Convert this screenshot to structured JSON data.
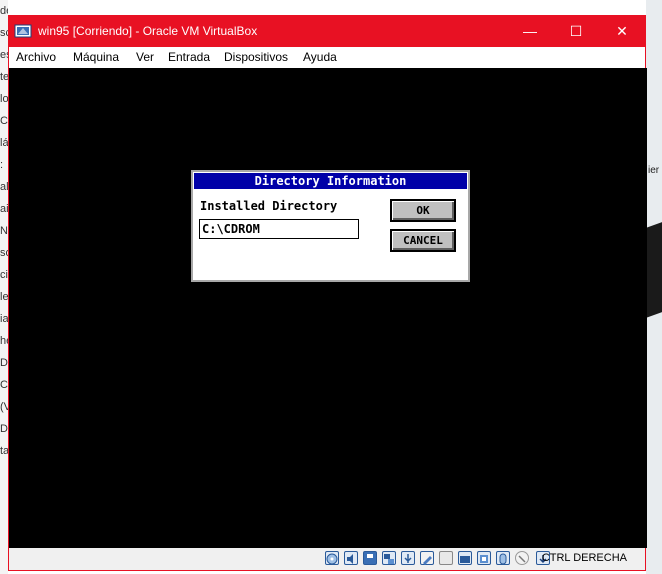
{
  "window": {
    "title": "win95 [Corriendo] - Oracle VM VirtualBox",
    "minimize_glyph": "—",
    "maximize_glyph": "☐",
    "close_glyph": "✕"
  },
  "menu": [
    "Archivo",
    "Máquina",
    "Ver",
    "Entrada",
    "Dispositivos",
    "Ayuda"
  ],
  "background_left_fragments": [
    "de",
    "sc",
    "es",
    "te",
    "lo",
    "Co",
    "lá",
    ":",
    "al",
    "ai",
    "N",
    "so",
    "ci",
    "le",
    "ia",
    "he",
    "D",
    "C",
    "(V",
    "D",
    "ta"
  ],
  "background_right_fragment": "ier",
  "dialog": {
    "title": "Directory Information",
    "label": "Installed Directory",
    "input_value": "C:\\CDROM",
    "ok_label": "OK",
    "cancel_label": "CANCEL"
  },
  "statusbar": {
    "icons": [
      "optical-drive-icon",
      "audio-icon",
      "floppy-icon",
      "network-icon",
      "usb-icon",
      "shared-folders-icon",
      "display-icon",
      "video-capture-icon",
      "virtualization-icon",
      "mouse-integration-icon",
      "keyboard-capture-icon"
    ],
    "host_key": "CTRL DERECHA"
  },
  "colors": {
    "titlebar": "#e81123",
    "guest_bg": "#000000",
    "dialog_title_bg": "#0000a8"
  }
}
